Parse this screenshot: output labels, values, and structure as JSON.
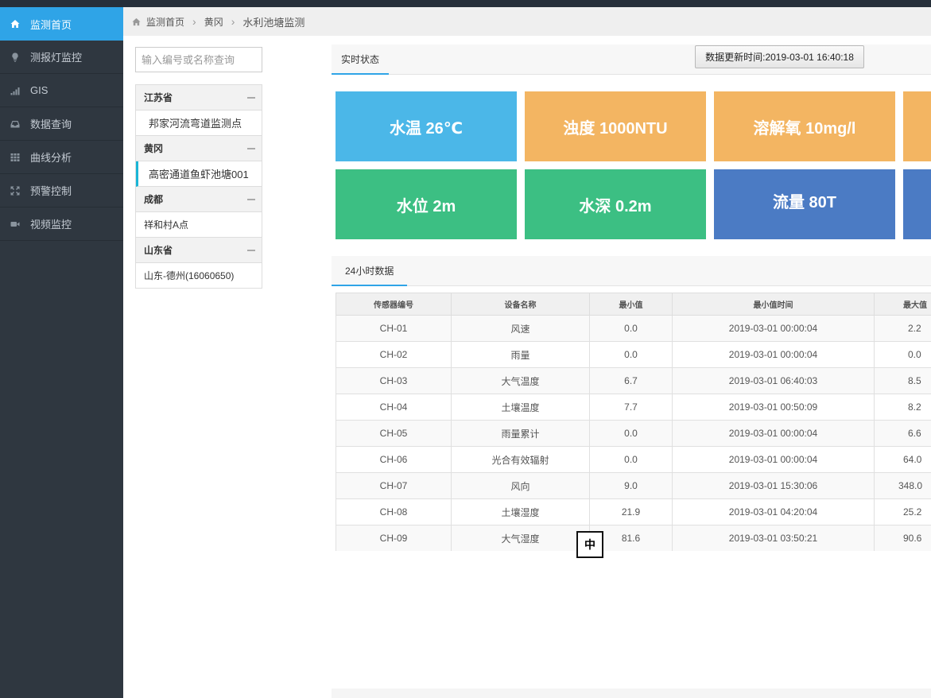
{
  "sidebar": {
    "items": [
      {
        "label": "监测首页",
        "icon": "home-icon",
        "active": true
      },
      {
        "label": "测报灯监控",
        "icon": "bulb-icon",
        "active": false
      },
      {
        "label": "GIS",
        "icon": "signal-icon",
        "active": false
      },
      {
        "label": "数据查询",
        "icon": "inbox-icon",
        "active": false
      },
      {
        "label": "曲线分析",
        "icon": "grid-icon",
        "active": false
      },
      {
        "label": "预警控制",
        "icon": "expand-icon",
        "active": false
      },
      {
        "label": "视频监控",
        "icon": "video-icon",
        "active": false
      }
    ]
  },
  "breadcrumb": {
    "items": [
      "监测首页",
      "黄冈"
    ],
    "current": "水利池塘监测"
  },
  "stations": {
    "search_placeholder": "输入编号或名称查询",
    "groups": [
      {
        "name": "江苏省",
        "items": [
          "邦家河流弯道监测点"
        ]
      },
      {
        "name": "黄冈",
        "items": [
          "高密通道鱼虾池塘001"
        ]
      },
      {
        "name": "成都",
        "items": [
          "祥和村A点"
        ]
      },
      {
        "name": "山东省",
        "items": [
          "山东-德州(16060650)"
        ]
      }
    ]
  },
  "realtime": {
    "tab": "实时状态",
    "update_time": "数据更新时间:2019-03-01 16:40:18",
    "tiles": [
      {
        "label": "水温 26℃",
        "color": "#4bb7e8"
      },
      {
        "label": "浊度 1000NTU",
        "color": "#f3b562"
      },
      {
        "label": "溶解氧 10mg/l",
        "color": "#f3b562"
      },
      {
        "label": "",
        "color": "#f3b562"
      },
      {
        "label": "水位 2m",
        "color": "#3cbf83"
      },
      {
        "label": "水深 0.2m",
        "color": "#3cbf83"
      },
      {
        "label": "流量 80T",
        "color": "#4b7bc4"
      },
      {
        "label": "",
        "color": "#4b7bc4"
      }
    ]
  },
  "history": {
    "tab": "24小时数据",
    "columns": [
      "传感器编号",
      "设备名称",
      "最小值",
      "最小值时间",
      "最大值"
    ],
    "rows": [
      [
        "CH-01",
        "风速",
        "0.0",
        "2019-03-01 00:00:04",
        "2.2"
      ],
      [
        "CH-02",
        "雨量",
        "0.0",
        "2019-03-01 00:00:04",
        "0.0"
      ],
      [
        "CH-03",
        "大气温度",
        "6.7",
        "2019-03-01 06:40:03",
        "8.5"
      ],
      [
        "CH-04",
        "土壤温度",
        "7.7",
        "2019-03-01 00:50:09",
        "8.2"
      ],
      [
        "CH-05",
        "雨量累计",
        "0.0",
        "2019-03-01 00:00:04",
        "6.6"
      ],
      [
        "CH-06",
        "光合有效辐射",
        "0.0",
        "2019-03-01 00:00:04",
        "64.0"
      ],
      [
        "CH-07",
        "风向",
        "9.0",
        "2019-03-01 15:30:06",
        "348.0"
      ],
      [
        "CH-08",
        "土壤湿度",
        "21.9",
        "2019-03-01 04:20:04",
        "25.2"
      ],
      [
        "CH-09",
        "大气湿度",
        "81.6",
        "2019-03-01 03:50:21",
        "90.6"
      ]
    ]
  },
  "ime_indicator": "中"
}
